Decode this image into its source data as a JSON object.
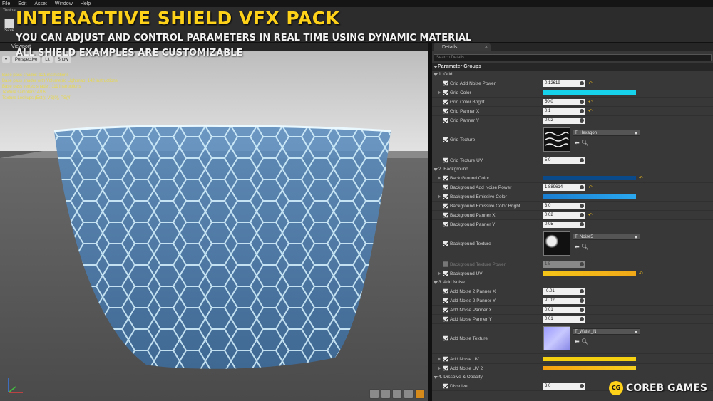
{
  "menu": [
    "File",
    "Edit",
    "Asset",
    "Window",
    "Help"
  ],
  "toolbar": {
    "tab_label": "Toolbar",
    "save_label": "Save"
  },
  "overlay": {
    "title": "INTERACTIVE SHIELD VFX PACK",
    "line1": "YOU CAN ADJUST AND CONTROL PARAMETERS IN REAL TIME USING DYNAMIC MATERIAL",
    "line2": "ALL SHIELD EXAMPLES ARE CUSTOMIZABLE"
  },
  "viewport": {
    "tab_label": "Viewport",
    "buttons": [
      "Perspective",
      "Lit",
      "Show"
    ],
    "stats": [
      "Base pass shader: 121 instructions",
      "Base pass shader with Volumetric Lightmap: 142 instructions",
      "Base pass vertex shader: 111 instructions",
      "Texture samplers: 4/16",
      "Texture Lookups (Est.): VS(0), PS(4)"
    ]
  },
  "details": {
    "tab_label": "Details",
    "search_placeholder": "Search Details",
    "section": "Parameter Groups",
    "groups": [
      {
        "label": "1. Grid"
      },
      {
        "label": "2. Background"
      },
      {
        "label": "3. Add Noise"
      },
      {
        "label": "4. Dissolve & Opacity"
      }
    ],
    "rows": [
      {
        "name": "Grid Add Noise Power",
        "value": "0.12619",
        "kind": "scalar",
        "reset": true
      },
      {
        "name": "Grid Color",
        "kind": "color",
        "color": "#16d2ea"
      },
      {
        "name": "Grid Color Bright",
        "value": "50.0",
        "kind": "scalar",
        "reset": true
      },
      {
        "name": "Grid Panner X",
        "value": "0.1",
        "kind": "scalar",
        "reset": true
      },
      {
        "name": "Grid Panner Y",
        "value": "0.02",
        "kind": "scalar"
      },
      {
        "name": "Grid Texture",
        "kind": "texture",
        "texture": "T_Hexagon"
      },
      {
        "name": "Grid Texture UV",
        "value": "5.0",
        "kind": "scalar"
      },
      {
        "name": "Back Ground Color",
        "kind": "color",
        "color": "#0a4a8a",
        "reset": true
      },
      {
        "name": "Background Add Noise Power",
        "value": "1.889614",
        "kind": "scalar",
        "reset": true
      },
      {
        "name": "Background Emissive Color",
        "kind": "color",
        "color": "#1a8ee0"
      },
      {
        "name": "Background Emissive Color Bright",
        "value": "3.0",
        "kind": "scalar"
      },
      {
        "name": "Background Panner X",
        "value": "0.02",
        "kind": "scalar",
        "reset": true
      },
      {
        "name": "Background Panner Y",
        "value": "0.05",
        "kind": "scalar"
      },
      {
        "name": "Background Texture",
        "kind": "texture",
        "texture": "T_Noise5"
      },
      {
        "name": "Background Texture Power",
        "value": "1.5",
        "kind": "scalar",
        "disabled": true
      },
      {
        "name": "Background UV",
        "kind": "color",
        "color": "#f5c518",
        "reset": true
      },
      {
        "name": "Add Noise 2 Panner X",
        "value": "-0.01",
        "kind": "scalar"
      },
      {
        "name": "Add Noise 2 Panner Y",
        "value": "-0.02",
        "kind": "scalar"
      },
      {
        "name": "Add Noise Panner X",
        "value": "0.01",
        "kind": "scalar"
      },
      {
        "name": "Add Noise Panner Y",
        "value": "0.01",
        "kind": "scalar"
      },
      {
        "name": "Add Noise Texture",
        "kind": "texture",
        "texture": "T_Water_N"
      },
      {
        "name": "Add Noise UV",
        "kind": "color",
        "color": "#f5d010"
      },
      {
        "name": "Add Noise UV 2",
        "kind": "color",
        "color": "#f5a010"
      },
      {
        "name": "Dissolve",
        "value": "3.0",
        "kind": "scalar"
      }
    ]
  },
  "brand": {
    "logo": "CG",
    "name": "COREB GAMES"
  }
}
